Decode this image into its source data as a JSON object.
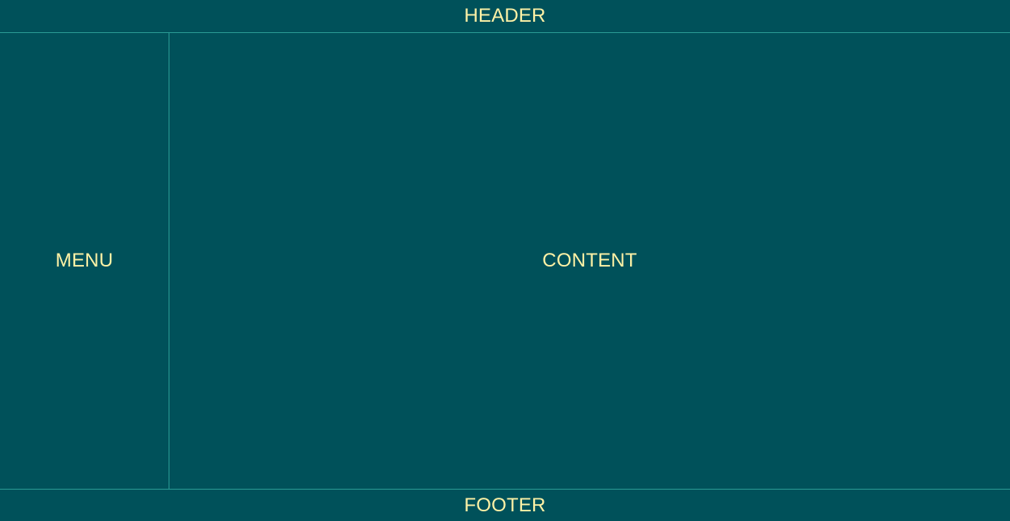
{
  "header": {
    "label": "HEADER"
  },
  "menu": {
    "label": "MENU"
  },
  "content": {
    "label": "CONTENT"
  },
  "footer": {
    "label": "FOOTER"
  },
  "colors": {
    "background": "#00515a",
    "text": "#fff2a6",
    "divider": "#2a9b95"
  }
}
